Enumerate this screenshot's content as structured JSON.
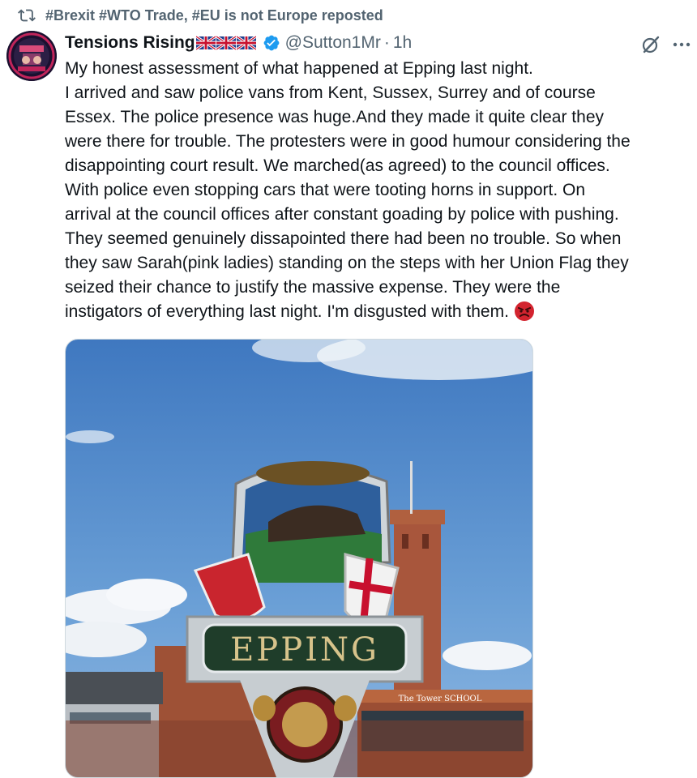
{
  "repost": {
    "label": "#Brexit #WTO Trade, #EU is not Europe reposted",
    "icon": "repost-icon"
  },
  "post": {
    "author_name": "Tensions Rising",
    "flags": [
      "uk-flag",
      "uk-flag",
      "uk-flag"
    ],
    "verified": true,
    "handle": "@Sutton1Mr",
    "separator": "·",
    "time": "1h",
    "text_lines": [
      "My honest assessment of what happened at Epping last night.",
      "I arrived and saw police vans from Kent, Sussex, Surrey and of course",
      "Essex. The police presence was huge.And they made it quite clear they",
      "were there for trouble. The protesters were in good humour considering the",
      "disappointing court result. We marched(as agreed) to the council offices.",
      "With police even stopping cars that were tooting horns in support. On",
      "arrival at the council offices after constant goading by police with pushing.",
      "They seemed genuinely dissapointed there had been no trouble. So when",
      "they saw Sarah(pink ladies) standing on the steps with her Union Flag they",
      "seized their chance to justify the massive expense. They were the",
      "instigators of everything last night. I'm disgusted with them."
    ],
    "trailing_emoji": "angry-face-emoji"
  },
  "media": {
    "sign_text": "EPPING",
    "school_sign": "The Tower SCHOOL",
    "colors": {
      "sky": "#4f86c6",
      "sign_green": "#1f3d2a",
      "brick": "#a0543a"
    }
  },
  "colors": {
    "text": "#0f1419",
    "muted": "#536471",
    "verified_blue": "#1d9bf0"
  }
}
